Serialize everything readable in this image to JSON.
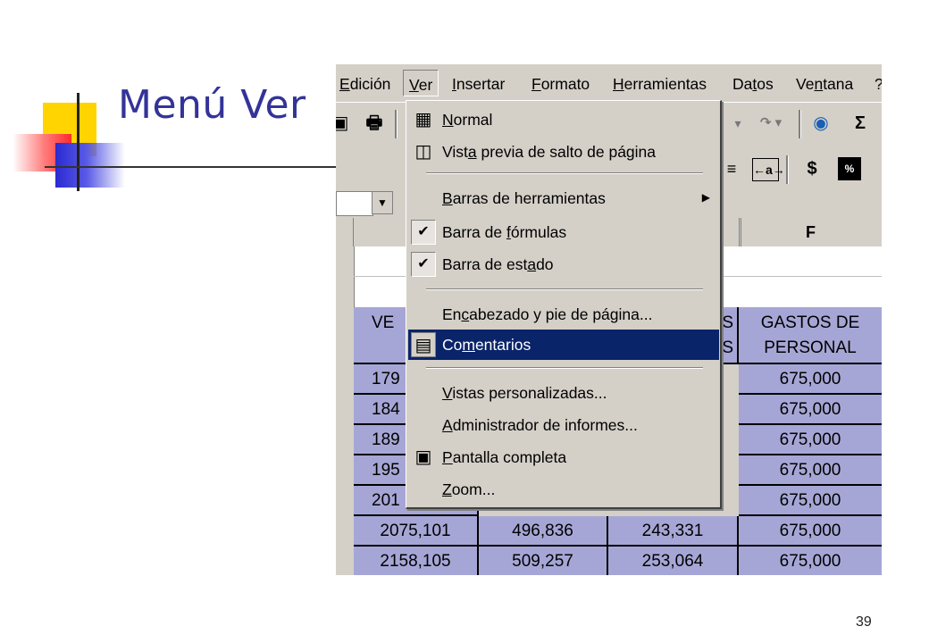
{
  "slide": {
    "title": "Menú Ver",
    "number": "39"
  },
  "menubar": {
    "items": [
      "Edición",
      "Ver",
      "Insertar",
      "Formato",
      "Herramientas",
      "Datos",
      "Ventana",
      "?"
    ]
  },
  "toolbar": {
    "sigma": "Σ",
    "dollar": "$",
    "redo": "↷ ▾",
    "undo": "▾"
  },
  "namebox": {
    "drop": "▼"
  },
  "columns": {
    "f": "F"
  },
  "table": {
    "headers": {
      "ventas_partial": "VE",
      "partial_s1": "S",
      "partial_s2": "S",
      "gastos_line1": "GASTOS DE",
      "gastos_line2": "PERSONAL"
    },
    "rows": [
      [
        "179",
        "",
        "",
        "675,000"
      ],
      [
        "184",
        "",
        "",
        "675,000"
      ],
      [
        "189",
        "",
        "",
        "675,000"
      ],
      [
        "195",
        "",
        "",
        "675,000"
      ],
      [
        "201",
        "",
        "",
        "675,000"
      ],
      [
        "2075,101",
        "496,836",
        "243,331",
        "675,000"
      ],
      [
        "2158,105",
        "509,257",
        "253,064",
        "675,000"
      ]
    ]
  },
  "menu": {
    "items": [
      {
        "label": "Normal",
        "icon": "normal-view-icon"
      },
      {
        "label": "Vista previa de salto de página",
        "icon": "page-break-preview-icon"
      },
      {
        "label": "Barras de herramientas",
        "submenu": true
      },
      {
        "label": "Barra de fórmulas",
        "checked": true
      },
      {
        "label": "Barra de estado",
        "checked": true
      },
      {
        "label": "Encabezado y pie de página..."
      },
      {
        "label": "Comentarios",
        "icon": "comments-icon",
        "highlighted": true
      },
      {
        "label": "Vistas personalizadas..."
      },
      {
        "label": "Administrador de informes..."
      },
      {
        "label": "Pantalla completa",
        "icon": "full-screen-icon"
      },
      {
        "label": "Zoom..."
      }
    ],
    "check_glyph": "✔",
    "arrow_glyph": "▶"
  },
  "colors": {
    "title": "#333399",
    "menu_bg": "#d4d0c8",
    "highlight": "#0a246a",
    "cell_bg": "#a6a6d6"
  }
}
